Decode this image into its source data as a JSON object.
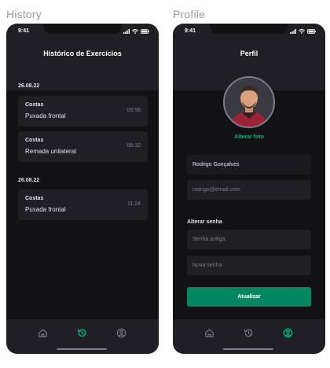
{
  "frames": {
    "history_label": "History",
    "profile_label": "Profile"
  },
  "status_bar": {
    "time": "9:41"
  },
  "history": {
    "title": "Histórico de Exercícios",
    "sections": [
      {
        "date": "26.08.22",
        "items": [
          {
            "group": "Costas",
            "name": "Puxada frontal",
            "time": "08:56"
          },
          {
            "group": "Costas",
            "name": "Remada unilateral",
            "time": "08:32"
          }
        ]
      },
      {
        "date": "26.08.22",
        "items": [
          {
            "group": "Costas",
            "name": "Puxada frontal",
            "time": "11:24"
          }
        ]
      }
    ]
  },
  "profile": {
    "title": "Perfil",
    "change_photo": "Alterar foto",
    "name_value": "Rodrigo Gonçalves",
    "email_placeholder": "rodrigo@email.com",
    "password_section": "Alterar senha",
    "old_password_placeholder": "Senha antiga",
    "new_password_placeholder": "Nova senha",
    "submit_label": "Atualizar"
  },
  "tabs": {
    "items": [
      "home-icon",
      "history-icon",
      "profile-icon"
    ],
    "history_screen_active": "history-icon",
    "profile_screen_active": "profile-icon"
  },
  "colors": {
    "accent": "#00b37e",
    "button": "#00875f",
    "background": "#121214",
    "surface": "#202024",
    "muted": "#7c7c8a"
  }
}
